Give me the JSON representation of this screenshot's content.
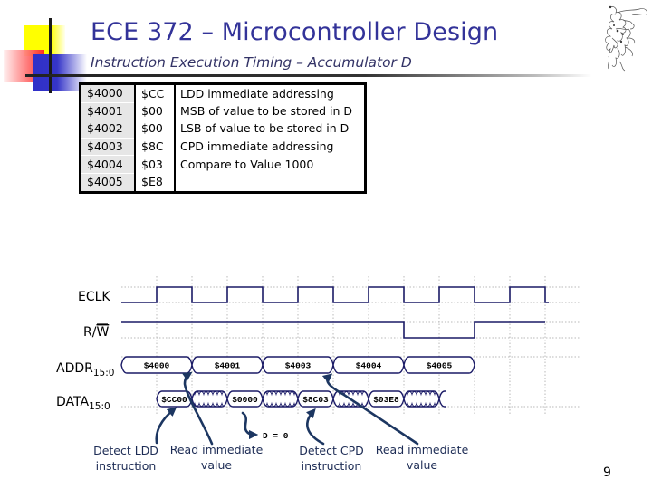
{
  "slide": {
    "title": "ECE 372 – Microcontroller Design",
    "subtitle": "Instruction Execution Timing – Accumulator D",
    "page_number": "9"
  },
  "table": {
    "rows": [
      {
        "address": "$4000",
        "value": "$CC",
        "description": "LDD immediate addressing"
      },
      {
        "address": "$4001",
        "value": "$00",
        "description": "MSB of value to be stored in D"
      },
      {
        "address": "$4002",
        "value": "$00",
        "description": "LSB of value to be stored in D"
      },
      {
        "address": "$4003",
        "value": "$8C",
        "description": "CPD immediate addressing"
      },
      {
        "address": "$4004",
        "value": "$03",
        "description": "Compare to Value 1000"
      },
      {
        "address": "$4005",
        "value": "$E8",
        "description": ""
      }
    ]
  },
  "timing": {
    "colors": {
      "waveform": "#1a1a66",
      "arrow": "#1c3661",
      "grid": "#b8b8b8"
    },
    "half_cycles": 12,
    "eclk": {
      "label": "ECLK",
      "levels": [
        0,
        1,
        0,
        1,
        0,
        1,
        0,
        1,
        0,
        1,
        0,
        1
      ],
      "final_level": 0
    },
    "rw": {
      "label_prefix": "R/",
      "label_overlined": "W",
      "levels": [
        1,
        1,
        1,
        1,
        1,
        1,
        1,
        1,
        0,
        0,
        1,
        1
      ]
    },
    "addr": {
      "label": "ADDR",
      "subscript": "15:0",
      "segments": [
        {
          "label": "$4000",
          "start": 0,
          "end": 2
        },
        {
          "label": "$4001",
          "start": 2,
          "end": 4
        },
        {
          "label": "$4003",
          "start": 4,
          "end": 6
        },
        {
          "label": "$4004",
          "start": 6,
          "end": 8
        },
        {
          "label": "$4005",
          "start": 8,
          "end": 10
        }
      ]
    },
    "data": {
      "label": "DATA",
      "subscript": "15:0",
      "segments": [
        {
          "label": "$CC00",
          "start": 1,
          "end": 2
        },
        {
          "label": null,
          "start": 2,
          "end": 3
        },
        {
          "label": "$0000",
          "start": 3,
          "end": 4
        },
        {
          "label": null,
          "start": 4,
          "end": 5
        },
        {
          "label": "$8C03",
          "start": 5,
          "end": 6
        },
        {
          "label": null,
          "start": 6,
          "end": 7
        },
        {
          "label": "$03E8",
          "start": 7,
          "end": 8
        },
        {
          "label": null,
          "start": 8,
          "end": 9
        }
      ],
      "trailing_open_at": 9
    },
    "result_note": "D = 0",
    "annotations": [
      {
        "line1": "Detect LDD",
        "line2": "instruction"
      },
      {
        "line1": "Read immediate",
        "line2": "value"
      },
      {
        "line1": "Detect CPD",
        "line2": "instruction"
      },
      {
        "line1": "Read immediate",
        "line2": "value"
      }
    ]
  }
}
